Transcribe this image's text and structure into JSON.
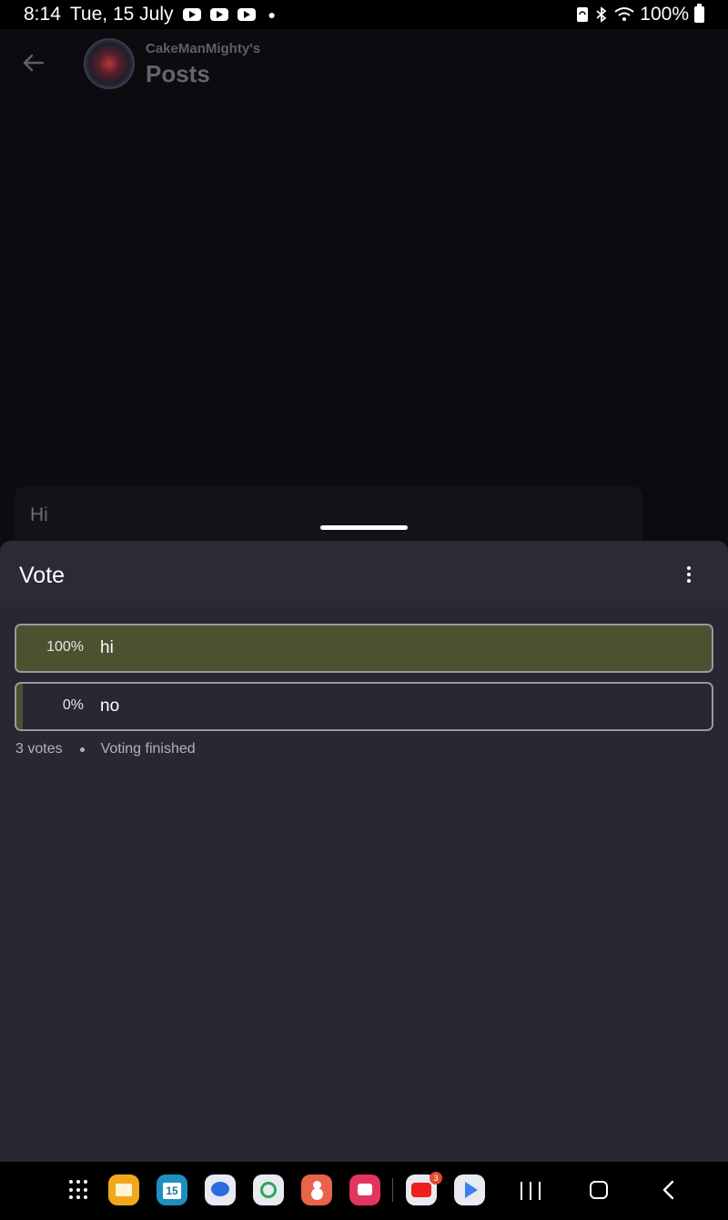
{
  "status_bar": {
    "time": "8:14",
    "date": "Tue, 15 July",
    "battery": "100%"
  },
  "header": {
    "back_icon": "arrow-left-icon",
    "subtitle": "CakeManMighty's",
    "title": "Posts"
  },
  "post": {
    "text": "Hi"
  },
  "vote_sheet": {
    "title": "Vote",
    "more_icon": "more-vertical-icon",
    "options": [
      {
        "percent_label": "100%",
        "label": "hi",
        "fraction": 1.0
      },
      {
        "percent_label": "0%",
        "label": "no",
        "fraction": 0.0
      }
    ],
    "votes": "3 votes",
    "status": "Voting finished",
    "accent_color": "#4c5230"
  },
  "taskbar": {
    "apps": [
      {
        "name": "apps-grid-icon"
      },
      {
        "name": "files-app-icon"
      },
      {
        "name": "calendar-app-icon",
        "label": "15"
      },
      {
        "name": "messages-app-icon"
      },
      {
        "name": "messenger-app-icon"
      },
      {
        "name": "contacts-app-icon"
      },
      {
        "name": "camera-app-icon"
      },
      {
        "name": "youtube-app-icon",
        "badge": "3"
      },
      {
        "name": "play-store-app-icon"
      }
    ],
    "youtube_badge": "3",
    "calendar_day": "15"
  }
}
